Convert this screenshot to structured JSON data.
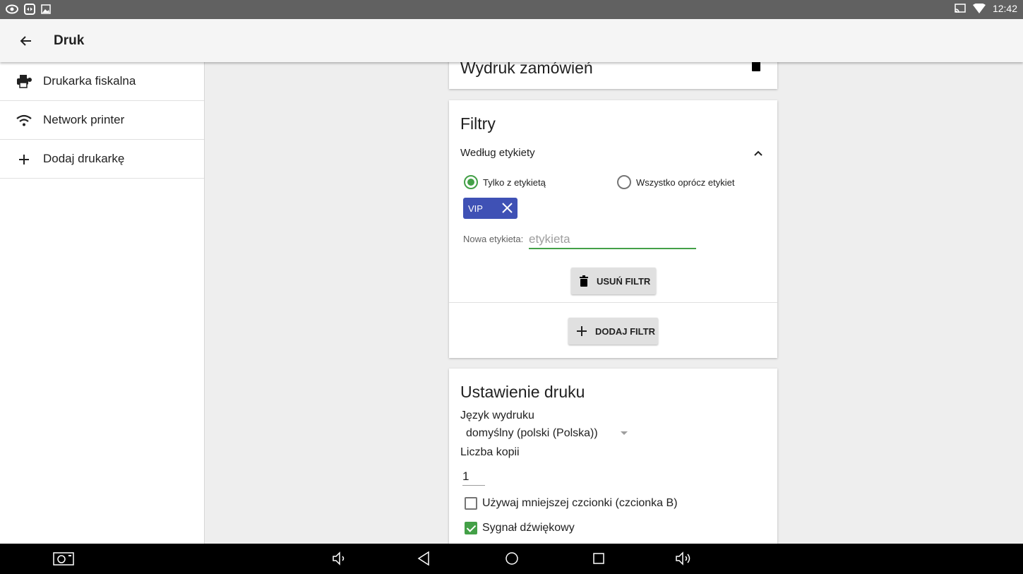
{
  "status_bar": {
    "time": "12:42",
    "icons": [
      "eye-icon",
      "teamviewer-icon",
      "image-icon",
      "cast-icon",
      "wifi-icon"
    ]
  },
  "app_bar": {
    "title": "Druk",
    "back_icon": "arrow-left-icon"
  },
  "sidebar": {
    "items": [
      {
        "label": "Drukarka fiskalna",
        "icon": "printer-icon"
      },
      {
        "label": "Network printer",
        "icon": "wifi-icon"
      },
      {
        "label": "Dodaj drukarkę",
        "icon": "plus-icon"
      }
    ]
  },
  "order_print_card": {
    "title": "Wydruk zamówień",
    "icon": "trash-icon"
  },
  "filters_card": {
    "title": "Filtry",
    "subheading": "Według etykiety",
    "radio_options": [
      {
        "label": "Tylko z etykietą",
        "checked": true
      },
      {
        "label": "Wszystko oprócz etykiet",
        "checked": false
      }
    ],
    "chips": [
      {
        "label": "VIP"
      }
    ],
    "new_tag_label": "Nowa etykieta:",
    "new_tag_placeholder": "etykieta",
    "remove_filter_label": "USUŃ FILTR",
    "add_filter_label": "DODAJ FILTR"
  },
  "print_settings_card": {
    "title": "Ustawienie druku",
    "language_label": "Język wydruku",
    "language_value": "domyślny (polski (Polska))",
    "copies_label": "Liczba kopii",
    "copies_value": "1",
    "checkboxes": [
      {
        "label": "Używaj mniejszej czcionki (czcionka B)",
        "checked": false
      },
      {
        "label": "Sygnał dźwiękowy",
        "checked": true
      }
    ]
  },
  "nav_bar": {
    "icons": [
      "screenshot-icon",
      "volume-down-icon",
      "back-icon",
      "home-icon",
      "recents-icon",
      "volume-up-icon"
    ]
  },
  "colors": {
    "accent_green": "#43a047",
    "chip_blue": "#3f51b5",
    "status_bar": "#616161",
    "nav_bar": "#000000"
  }
}
